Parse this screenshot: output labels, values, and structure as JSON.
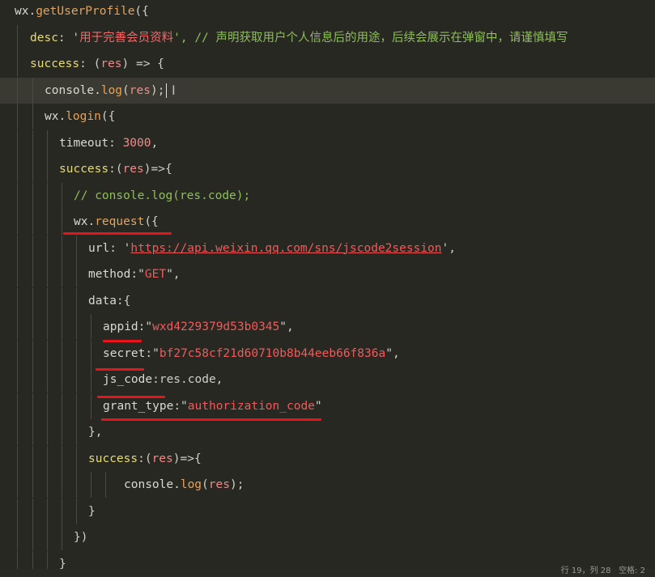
{
  "editor": {
    "lines": [
      [
        {
          "t": "wx.",
          "c": "plain"
        },
        {
          "t": "getUserProfile",
          "c": "method"
        },
        {
          "t": "({",
          "c": "punct"
        }
      ],
      [
        {
          "t": "desc",
          "c": "key"
        },
        {
          "t": ": '",
          "c": "punct"
        },
        {
          "t": "用于完善会员资料",
          "c": "chinese"
        },
        {
          "t": "', // ",
          "c": "comment"
        },
        {
          "t": "声明获取用户个人信息后的用途，后续会展示在弹窗中，请谨慎填写",
          "c": "chinese-comment"
        }
      ],
      [
        {
          "t": "success",
          "c": "key"
        },
        {
          "t": ": (",
          "c": "punct"
        },
        {
          "t": "res",
          "c": "number"
        },
        {
          "t": ") => {",
          "c": "punct"
        }
      ],
      [
        {
          "t": "console.",
          "c": "plain"
        },
        {
          "t": "log",
          "c": "method"
        },
        {
          "t": "(",
          "c": "punct"
        },
        {
          "t": "res",
          "c": "number"
        },
        {
          "t": ");",
          "c": "punct"
        }
      ],
      [
        {
          "t": "wx.",
          "c": "plain"
        },
        {
          "t": "login",
          "c": "method"
        },
        {
          "t": "({",
          "c": "punct"
        }
      ],
      [
        {
          "t": "timeout",
          "c": "plain"
        },
        {
          "t": ": ",
          "c": "punct"
        },
        {
          "t": "3000",
          "c": "number"
        },
        {
          "t": ",",
          "c": "punct"
        }
      ],
      [
        {
          "t": "success",
          "c": "key"
        },
        {
          "t": ":(",
          "c": "punct"
        },
        {
          "t": "res",
          "c": "number"
        },
        {
          "t": ")=>{",
          "c": "punct"
        }
      ],
      [
        {
          "t": "// console.log(res.code);",
          "c": "comment"
        }
      ],
      [
        {
          "t": "wx.",
          "c": "plain"
        },
        {
          "t": "request",
          "c": "method"
        },
        {
          "t": "({",
          "c": "punct"
        }
      ],
      [
        {
          "t": "url",
          "c": "plain"
        },
        {
          "t": ": '",
          "c": "punct"
        },
        {
          "t": "https://api.weixin.qq.com/sns/jscode2session",
          "c": "url"
        },
        {
          "t": "',",
          "c": "punct"
        }
      ],
      [
        {
          "t": "method",
          "c": "plain"
        },
        {
          "t": ":\"",
          "c": "punct"
        },
        {
          "t": "GET",
          "c": "string"
        },
        {
          "t": "\",",
          "c": "punct"
        }
      ],
      [
        {
          "t": "data",
          "c": "plain"
        },
        {
          "t": ":{",
          "c": "punct"
        }
      ],
      [
        {
          "t": "appid",
          "c": "plain"
        },
        {
          "t": ":\"",
          "c": "punct"
        },
        {
          "t": "wxd4229379d53b0345",
          "c": "string"
        },
        {
          "t": "\",",
          "c": "punct"
        }
      ],
      [
        {
          "t": "secret",
          "c": "plain"
        },
        {
          "t": ":\"",
          "c": "punct"
        },
        {
          "t": "bf27c58cf21d60710b8b44eeb66f836a",
          "c": "string"
        },
        {
          "t": "\",",
          "c": "punct"
        }
      ],
      [
        {
          "t": "js_code",
          "c": "plain"
        },
        {
          "t": ":res.code,",
          "c": "punct"
        }
      ],
      [
        {
          "t": "grant_type",
          "c": "plain"
        },
        {
          "t": ":\"",
          "c": "punct"
        },
        {
          "t": "authorization_code",
          "c": "string"
        },
        {
          "t": "\"",
          "c": "punct"
        }
      ],
      [
        {
          "t": "},",
          "c": "punct"
        }
      ],
      [
        {
          "t": "success",
          "c": "key"
        },
        {
          "t": ":(",
          "c": "punct"
        },
        {
          "t": "res",
          "c": "number"
        },
        {
          "t": ")=>{",
          "c": "punct"
        }
      ],
      [
        {
          "t": "console.",
          "c": "plain"
        },
        {
          "t": "log",
          "c": "method"
        },
        {
          "t": "(",
          "c": "punct"
        },
        {
          "t": "res",
          "c": "number"
        },
        {
          "t": ");",
          "c": "punct"
        }
      ],
      [
        {
          "t": "}",
          "c": "punct"
        }
      ],
      [
        {
          "t": "})",
          "c": "punct"
        }
      ],
      [
        {
          "t": "}",
          "c": "punct"
        }
      ]
    ]
  },
  "status_bar": {
    "position": "行 19，列 28",
    "indent": "空格: 2"
  }
}
